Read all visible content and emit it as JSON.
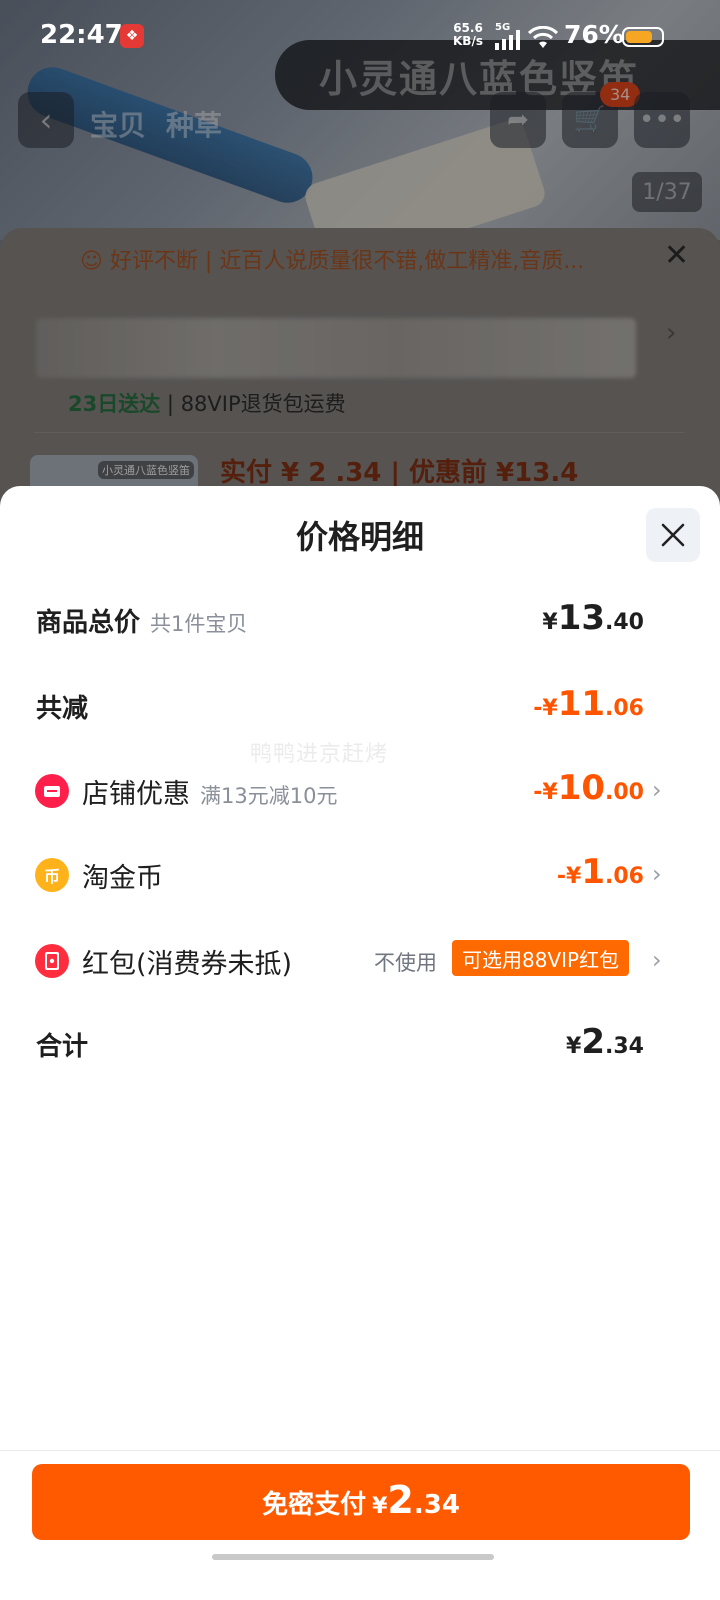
{
  "status_bar": {
    "time": "22:47",
    "net_speed_value": "65.6",
    "net_speed_unit": "KB/s",
    "network": "5G",
    "battery": "76%"
  },
  "background": {
    "title_banner": "小灵通八蓝色竖笛",
    "tabs": [
      "宝贝",
      "种草"
    ],
    "cart_badge": "34",
    "image_counter": "1/37",
    "review_text": "好评不断 | 近百人说质量很不错,做工精准,音质...",
    "delivery_date": "23日送达",
    "delivery_note": "88VIP退货包运费",
    "thumb_label": "小灵通八蓝色竖笛",
    "price_text": "实付 ¥ 2 .34  |  优惠前 ¥13.4"
  },
  "sheet": {
    "title": "价格明细",
    "watermark": "鸭鸭进京赶烤",
    "rows": {
      "total": {
        "label": "商品总价",
        "sub": "共1件宝贝",
        "cur": "¥",
        "int": "13",
        "dec": ".40"
      },
      "discount": {
        "label": "共减",
        "cur": "-¥",
        "int": "11",
        "dec": ".06"
      },
      "shop": {
        "label": "店铺优惠",
        "sub": "满13元减10元",
        "cur": "-¥",
        "int": "10",
        "dec": ".00"
      },
      "coin": {
        "label": "淘金币",
        "cur": "-¥",
        "int": "1",
        "dec": ".06"
      },
      "redpacket": {
        "label": "红包(消费券未抵)",
        "unused": "不使用",
        "pill": "可选用88VIP红包"
      },
      "sum": {
        "label": "合计",
        "cur": "¥",
        "int": "2",
        "dec": ".34"
      }
    },
    "pay_button": {
      "label": "免密支付",
      "cur": "¥",
      "int": "2",
      "dec": ".34"
    }
  },
  "colors": {
    "accent": "#ff5500",
    "button": "#ff5a00"
  }
}
